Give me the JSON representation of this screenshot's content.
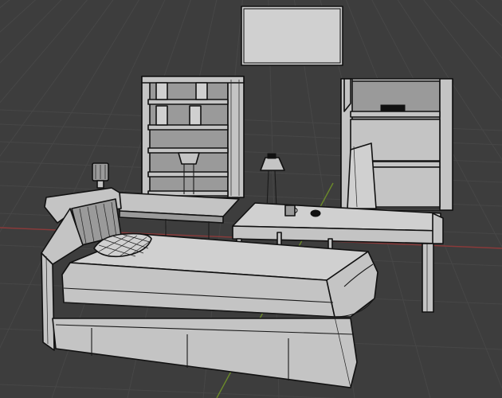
{
  "viewport": {
    "background": "#3d3d3d",
    "grid_color": "#474747",
    "axis_x_color": "#8b3a3a",
    "axis_y_color": "#6b8a2a",
    "mesh_color": "#c4c4c4",
    "wire_color": "#111111"
  },
  "scene_objects": [
    "wall-frame",
    "bookshelf-left",
    "bookshelf-right",
    "floor-lamp",
    "table-lamp",
    "side-table",
    "desk",
    "mug",
    "cup",
    "bed",
    "pillow"
  ]
}
